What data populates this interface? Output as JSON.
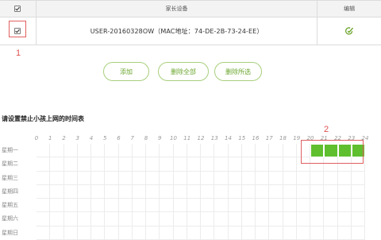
{
  "table": {
    "header": {
      "device_col": "家长设备",
      "edit_col": "编辑"
    },
    "rows": [
      {
        "device": "USER-20160328OW（MAC地址：74-DE-2B-73-24-EE）",
        "checked": true
      }
    ]
  },
  "buttons": {
    "add": "添加",
    "delete_all": "删除全部",
    "delete_selected": "删除所选"
  },
  "callouts": {
    "first": "1",
    "second": "2"
  },
  "schedule": {
    "title": "请设置禁止小孩上网的时间表",
    "hours": [
      "0",
      "1",
      "2",
      "3",
      "4",
      "5",
      "6",
      "7",
      "8",
      "9",
      "10",
      "11",
      "12",
      "13",
      "14",
      "15",
      "16",
      "17",
      "18",
      "19",
      "20",
      "21",
      "22",
      "23",
      "24"
    ],
    "days": [
      "星期一",
      "星期二",
      "星期三",
      "星期四",
      "星期五",
      "星期六",
      "星期日"
    ],
    "blocked": [
      {
        "day": "星期一",
        "hours": [
          20,
          21,
          22,
          23
        ]
      }
    ]
  },
  "colors": {
    "accent_green": "#5fbf2f",
    "button_text": "#6aa52c",
    "button_border": "#a8cf7c",
    "callout_red": "#e05050",
    "edit_icon": "#6aa52c"
  },
  "icons": {
    "checkbox": "checkbox-checked-icon",
    "edit": "edit-icon"
  }
}
